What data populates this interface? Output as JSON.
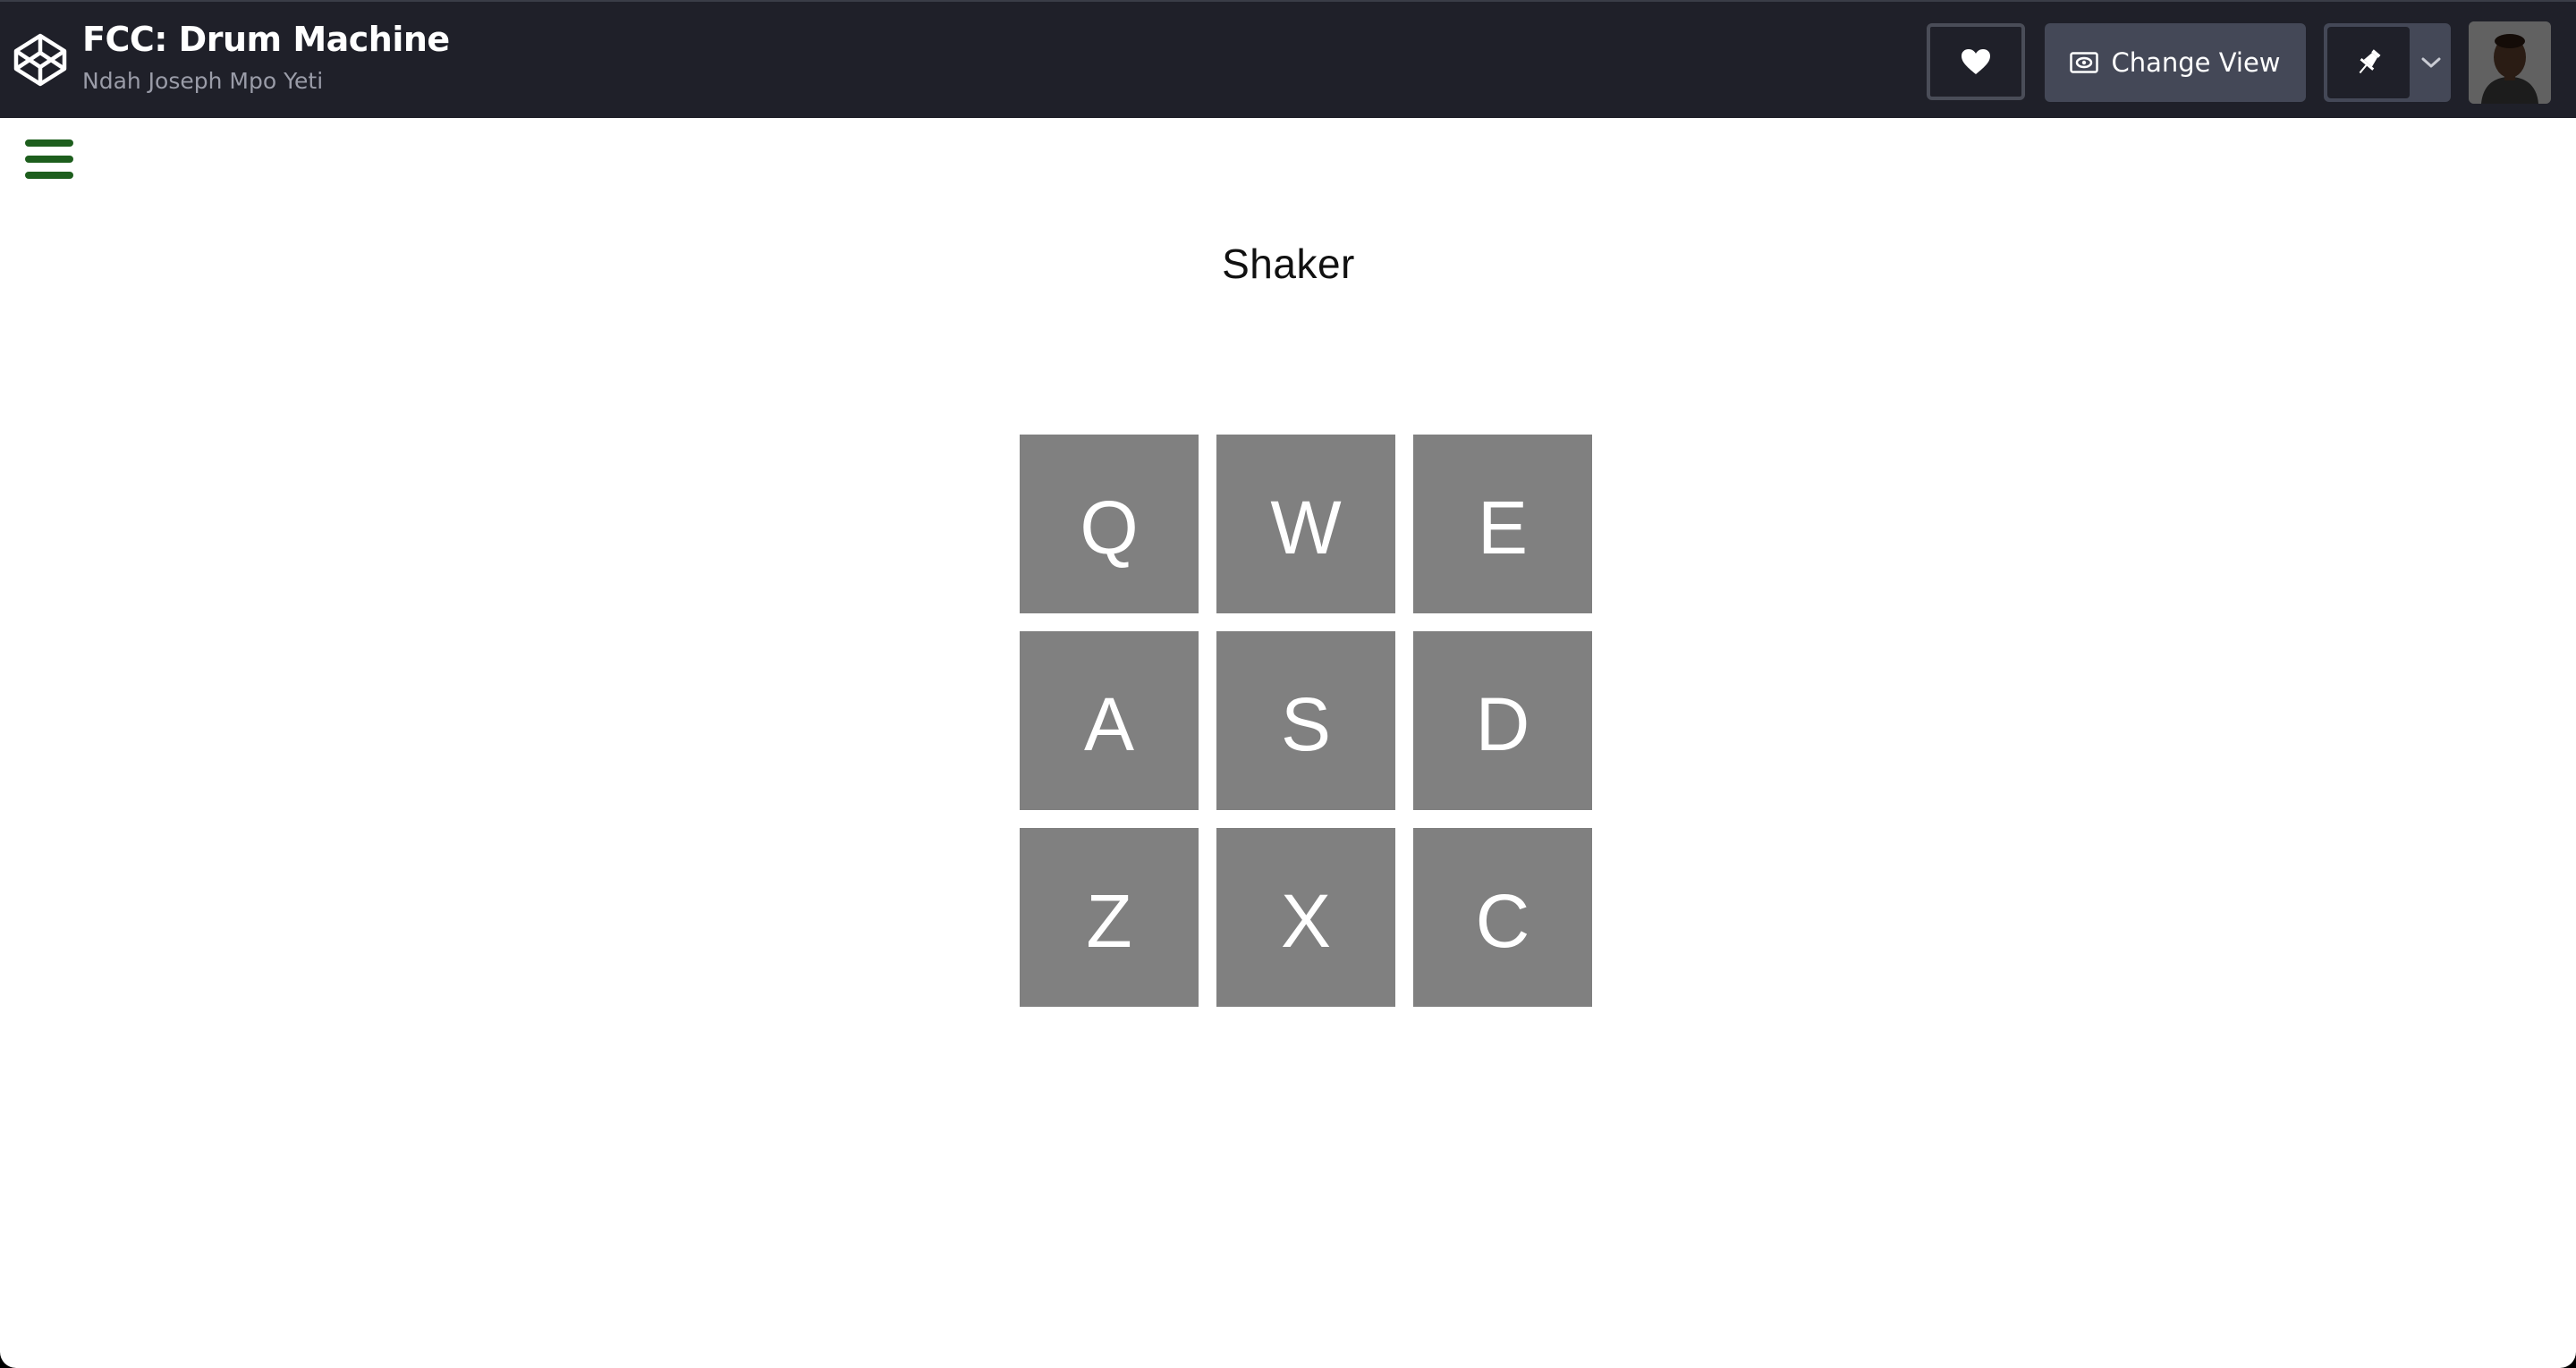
{
  "header": {
    "title": "FCC: Drum Machine",
    "author": "Ndah Joseph Mpo Yeti",
    "change_view_label": "Change View",
    "logo_icon": "codepen-logo-icon",
    "heart_icon": "heart-icon",
    "eye_icon": "eye-icon",
    "pin_icon": "pin-icon",
    "chevron_icon": "chevron-down-icon"
  },
  "menu": {
    "icon": "hamburger-menu-icon",
    "color": "#1d5e1d"
  },
  "display": {
    "text": "Shaker"
  },
  "pads": [
    {
      "key": "Q"
    },
    {
      "key": "W"
    },
    {
      "key": "E"
    },
    {
      "key": "A"
    },
    {
      "key": "S"
    },
    {
      "key": "D"
    },
    {
      "key": "Z"
    },
    {
      "key": "X"
    },
    {
      "key": "C"
    }
  ],
  "colors": {
    "header_bg": "#1f2029",
    "button_bg": "#444857",
    "pad_bg": "#808080",
    "pad_text": "#ffffff"
  }
}
